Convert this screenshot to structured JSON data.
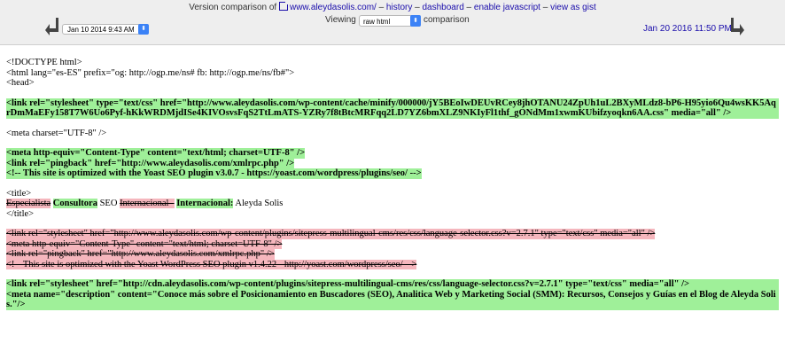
{
  "header": {
    "prefix": "Version comparison of",
    "site_link": "www.aleydasolis.com/",
    "sep": " – ",
    "links": [
      "history",
      "dashboard",
      "enable javascript",
      "view as gist"
    ],
    "left_date": "Jan 10 2014 9:43 AM",
    "viewing_label": "Viewing",
    "view_mode": "raw html",
    "comparison_label": "comparison",
    "right_date": "Jan 20 2016 11:50 PM"
  },
  "diff": {
    "b1": [
      "<!DOCTYPE html>",
      "<html lang=\"es-ES\" prefix=\"og: http://ogp.me/ns# fb: http://ogp.me/ns/fb#\">",
      "<head>"
    ],
    "b2": "<link rel=\"stylesheet\" type=\"text/css\" href=\"http://www.aleydasolis.com/wp-content/cache/minify/000000/jY5BEoIwDEUvRCey8jhOTANU24ZpUh1uL2BXyMLdz8-bP6-H95yio6Qu4wsKK5AqrDmMaEFy158T7W6Uo6Pyf-hKkWRDMjdISe4KIVOsvsFqS2TtLmATS-YZRy7f8tBtcMRFqq2LD7YZ6bmXLZ9NKIyFl1thf_gONdMm1xwmKUbifzyoqkn6AA.css\" media=\"all\" />",
    "b3": "<meta charset=\"UTF-8\" />",
    "b4": [
      "<meta http-equiv=\"Content-Type\" content=\"text/html; charset=UTF-8\" />",
      "<link rel=\"pingback\" href=\"http://www.aleydasolis.com/xmlrpc.php\" />",
      "<!-- This site is optimized with the Yoast SEO plugin v3.0.7 - https://yoast.com/wordpress/plugins/seo/ -->"
    ],
    "title_open": "<title>",
    "title_parts": {
      "del1": "Especialista",
      "add1": "Consultora",
      "plain1": " SEO ",
      "del2": "Internacional -",
      "add2": "Internacional:",
      "plain2": " Aleyda Solis"
    },
    "title_close": "</title>",
    "b6": [
      "<link rel=\"stylesheet\" href=\"http://www.aleydasolis.com/wp-content/plugins/sitepress-multilingual-cms/res/css/language-selector.css?v=2.7.1\" type=\"text/css\" media=\"all\" />",
      "<meta http-equiv=\"Content-Type\" content=\"text/html; charset=UTF-8\" />",
      "<link rel=\"pingback\" href=\"http://www.aleydasolis.com/xmlrpc.php\" />",
      "<!-- This site is optimized with the Yoast WordPress SEO plugin v1.4.22 - http://yoast.com/wordpress/seo/ -->"
    ],
    "b7": [
      "<link rel=\"stylesheet\" href=\"http://cdn.aleydasolis.com/wp-content/plugins/sitepress-multilingual-cms/res/css/language-selector.css?v=2.7.1\" type=\"text/css\" media=\"all\" />",
      "<meta name=\"description\" content=\"Conoce más sobre el Posicionamiento en Buscadores (SEO), Analitica Web y Marketing Social (SMM): Recursos, Consejos y Guías en el Blog de Aleyda Solis.\"/>"
    ]
  },
  "colors": {
    "added": "#9ff099",
    "removed": "#f5b6bd",
    "link": "#1a0dab"
  }
}
